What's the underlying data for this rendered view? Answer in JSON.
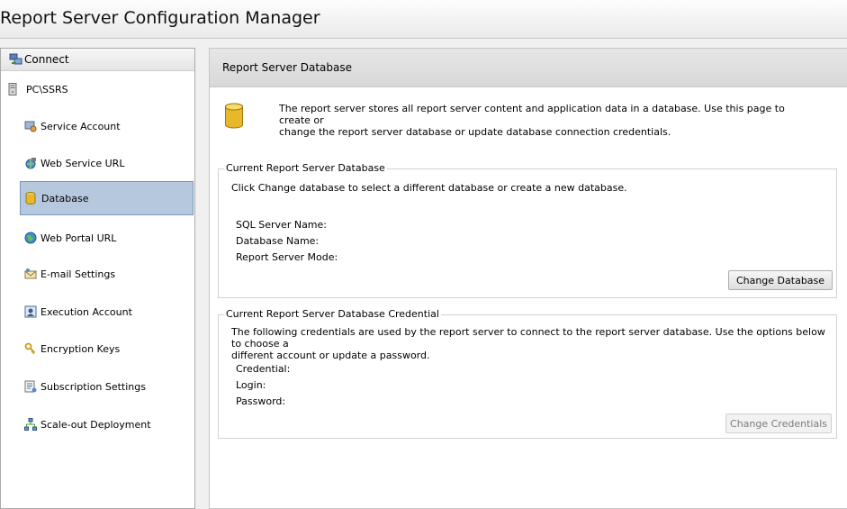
{
  "window": {
    "title": "Report Server Configuration Manager"
  },
  "sidebar": {
    "connect_label": "Connect",
    "server": "PC\\SSRS",
    "items": [
      {
        "label": "Service Account",
        "icon": "service-account-icon"
      },
      {
        "label": "Web Service URL",
        "icon": "web-service-url-icon"
      },
      {
        "label": "Database",
        "icon": "database-icon",
        "selected": true
      },
      {
        "label": "Web Portal URL",
        "icon": "globe-icon"
      },
      {
        "label": "E-mail Settings",
        "icon": "email-settings-icon"
      },
      {
        "label": "Execution Account",
        "icon": "execution-account-icon"
      },
      {
        "label": "Encryption Keys",
        "icon": "encryption-keys-icon"
      },
      {
        "label": "Subscription Settings",
        "icon": "subscription-settings-icon"
      },
      {
        "label": "Scale-out Deployment",
        "icon": "scale-out-deployment-icon"
      }
    ]
  },
  "main": {
    "header": "Report Server Database",
    "intro": [
      "The report server stores all report server content and application data in a database. Use this page to create or",
      "change the report server database or update database connection credentials."
    ],
    "current_db": {
      "legend": "Current Report Server Database",
      "description": "Click Change database to select a different database or create a new database.",
      "fields": [
        "SQL Server Name:",
        "Database Name:",
        "Report Server Mode:"
      ],
      "button": "Change Database"
    },
    "credential": {
      "legend": "Current Report Server Database Credential",
      "description": [
        "The following credentials are used by the report server to connect to the report server database.  Use the options below to choose a",
        "different account or update a password."
      ],
      "fields": [
        "Credential:",
        "Login:",
        "Password:"
      ],
      "button": "Change Credentials"
    }
  }
}
